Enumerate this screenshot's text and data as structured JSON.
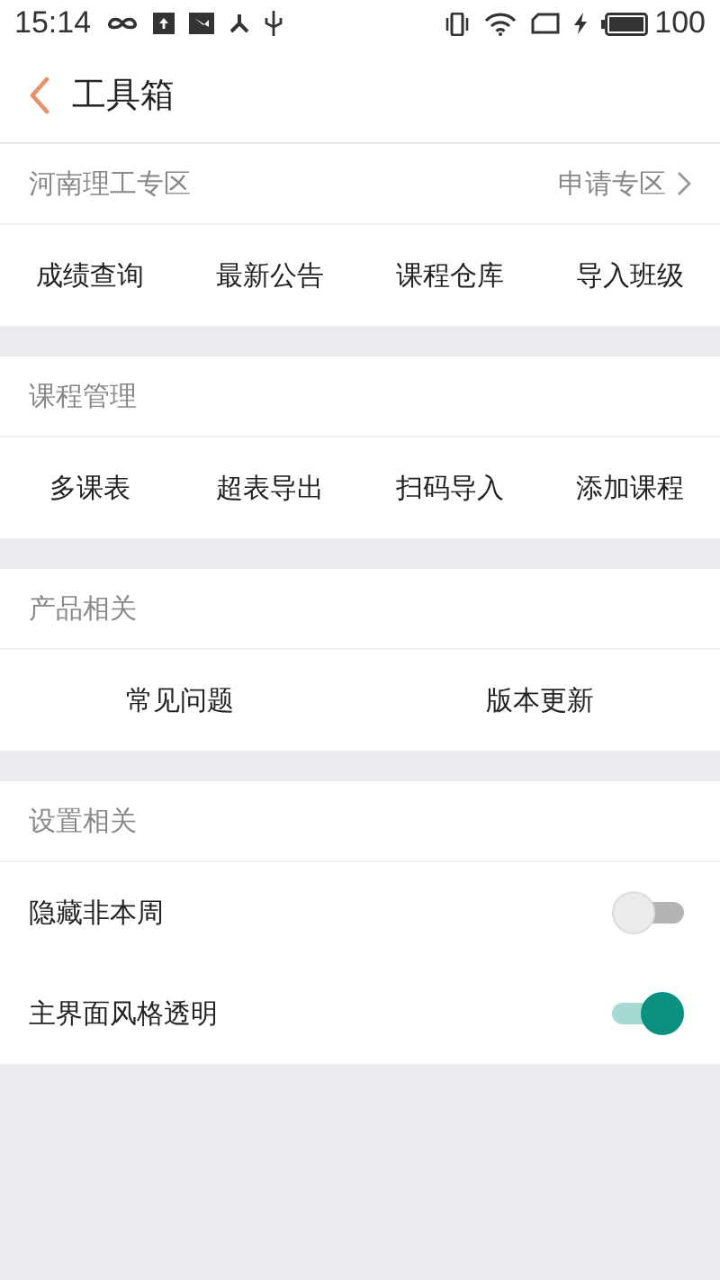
{
  "status_bar": {
    "time": "15:14",
    "battery": "100"
  },
  "header": {
    "title": "工具箱"
  },
  "sections": [
    {
      "kind": "grid",
      "title": "河南理工专区",
      "link": "申请专区",
      "items": [
        "成绩查询",
        "最新公告",
        "课程仓库",
        "导入班级"
      ]
    },
    {
      "kind": "grid",
      "title": "课程管理",
      "items": [
        "多课表",
        "超表导出",
        "扫码导入",
        "添加课程"
      ]
    },
    {
      "kind": "grid",
      "title": "产品相关",
      "items": [
        "常见问题",
        "版本更新"
      ]
    },
    {
      "kind": "toggles",
      "title": "设置相关",
      "rows": [
        {
          "label": "隐藏非本周",
          "on": false
        },
        {
          "label": "主界面风格透明",
          "on": true
        }
      ]
    }
  ]
}
